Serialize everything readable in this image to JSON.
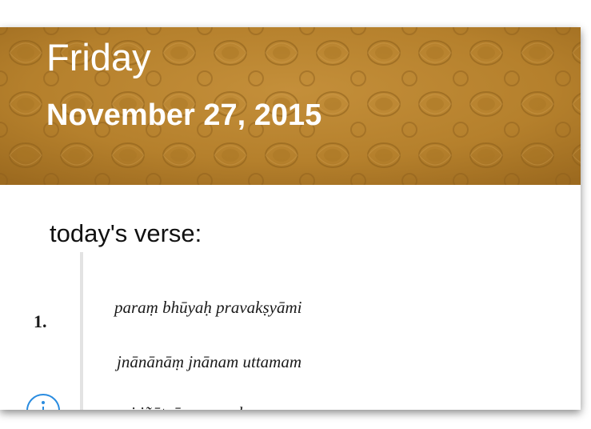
{
  "header": {
    "day": "Friday",
    "date": "November 27, 2015",
    "background_color": "#b8822e"
  },
  "verse": {
    "section_title": "today's verse:",
    "number": "1.",
    "lines": [
      "paraṃ bhūyaḥ pravakṣyāmi",
      "jnānānāṃ jnānam uttamam",
      "yaj jñātvā munayaḥ sarve"
    ],
    "info_icon": "info-icon"
  }
}
